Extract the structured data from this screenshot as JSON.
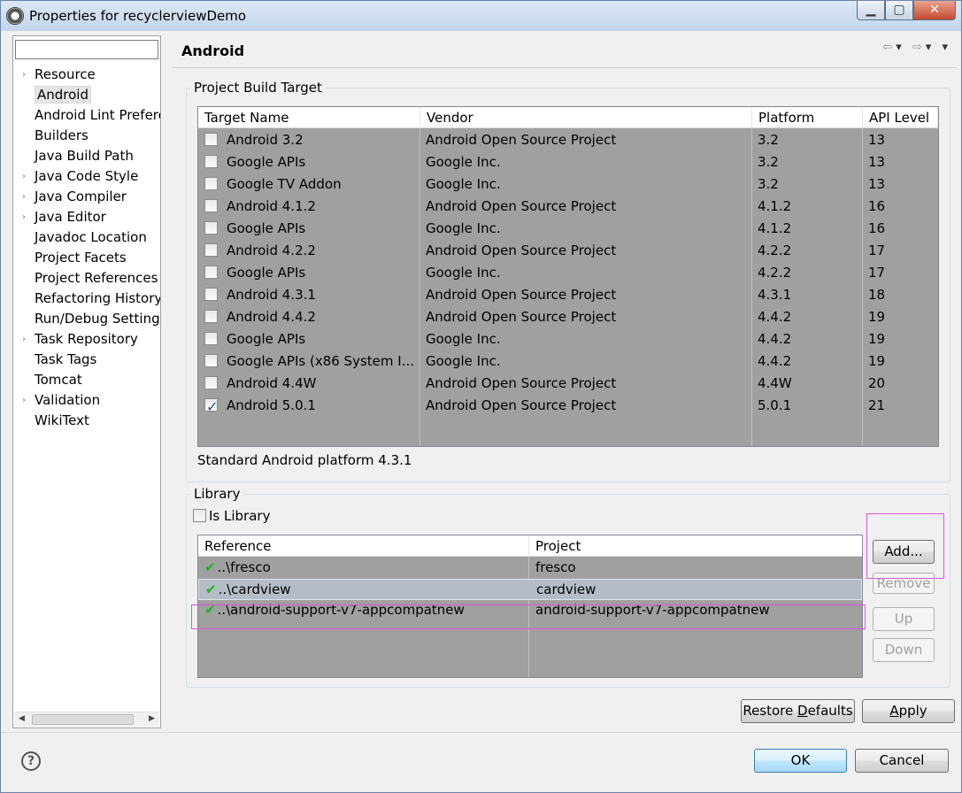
{
  "window": {
    "title": "Properties for recyclerviewDemo",
    "controls": [
      "minimize-icon",
      "maximize-icon",
      "close-icon"
    ]
  },
  "nav": {
    "filter_value": "",
    "items": [
      {
        "label": "Resource",
        "expandable": true
      },
      {
        "label": "Android",
        "expandable": false,
        "selected": true
      },
      {
        "label": "Android Lint Preferences",
        "expandable": false
      },
      {
        "label": "Builders",
        "expandable": false
      },
      {
        "label": "Java Build Path",
        "expandable": false
      },
      {
        "label": "Java Code Style",
        "expandable": true
      },
      {
        "label": "Java Compiler",
        "expandable": true
      },
      {
        "label": "Java Editor",
        "expandable": true
      },
      {
        "label": "Javadoc Location",
        "expandable": false
      },
      {
        "label": "Project Facets",
        "expandable": false
      },
      {
        "label": "Project References",
        "expandable": false
      },
      {
        "label": "Refactoring History",
        "expandable": false
      },
      {
        "label": "Run/Debug Settings",
        "expandable": false
      },
      {
        "label": "Task Repository",
        "expandable": true
      },
      {
        "label": "Task Tags",
        "expandable": false
      },
      {
        "label": "Tomcat",
        "expandable": false
      },
      {
        "label": "Validation",
        "expandable": true
      },
      {
        "label": "WikiText",
        "expandable": false
      }
    ]
  },
  "page": {
    "title": "Android"
  },
  "build_target": {
    "group_label": "Project Build Target",
    "columns": [
      "Target Name",
      "Vendor",
      "Platform",
      "API Level"
    ],
    "rows": [
      {
        "name": "Android 3.2",
        "vendor": "Android Open Source Project",
        "platform": "3.2",
        "api": "13",
        "checked": false
      },
      {
        "name": "Google APIs",
        "vendor": "Google Inc.",
        "platform": "3.2",
        "api": "13",
        "checked": false
      },
      {
        "name": "Google TV Addon",
        "vendor": "Google Inc.",
        "platform": "3.2",
        "api": "13",
        "checked": false
      },
      {
        "name": "Android 4.1.2",
        "vendor": "Android Open Source Project",
        "platform": "4.1.2",
        "api": "16",
        "checked": false
      },
      {
        "name": "Google APIs",
        "vendor": "Google Inc.",
        "platform": "4.1.2",
        "api": "16",
        "checked": false
      },
      {
        "name": "Android 4.2.2",
        "vendor": "Android Open Source Project",
        "platform": "4.2.2",
        "api": "17",
        "checked": false
      },
      {
        "name": "Google APIs",
        "vendor": "Google Inc.",
        "platform": "4.2.2",
        "api": "17",
        "checked": false
      },
      {
        "name": "Android 4.3.1",
        "vendor": "Android Open Source Project",
        "platform": "4.3.1",
        "api": "18",
        "checked": false
      },
      {
        "name": "Android 4.4.2",
        "vendor": "Android Open Source Project",
        "platform": "4.4.2",
        "api": "19",
        "checked": false
      },
      {
        "name": "Google APIs",
        "vendor": "Google Inc.",
        "platform": "4.4.2",
        "api": "19",
        "checked": false
      },
      {
        "name": "Google APIs (x86 System I...",
        "vendor": "Google Inc.",
        "platform": "4.4.2",
        "api": "19",
        "checked": false
      },
      {
        "name": "Android 4.4W",
        "vendor": "Android Open Source Project",
        "platform": "4.4W",
        "api": "20",
        "checked": false
      },
      {
        "name": "Android 5.0.1",
        "vendor": "Android Open Source Project",
        "platform": "5.0.1",
        "api": "21",
        "checked": true
      }
    ],
    "status_text": "Standard Android platform 4.3.1"
  },
  "library": {
    "group_label": "Library",
    "is_library_label": "Is Library",
    "is_library_checked": false,
    "columns": [
      "Reference",
      "Project"
    ],
    "rows": [
      {
        "reference": "..\\fresco",
        "project": "fresco",
        "status_icon": "check-icon"
      },
      {
        "reference": "..\\cardview",
        "project": "cardview",
        "status_icon": "check-icon",
        "selected": true
      },
      {
        "reference": "..\\android-support-v7-appcompatnew",
        "project": "android-support-v7-appcompatnew",
        "status_icon": "check-icon"
      }
    ],
    "buttons": {
      "add": "Add...",
      "remove": "Remove",
      "up": "Up",
      "down": "Down"
    }
  },
  "actions": {
    "restore_defaults_pre": "Restore ",
    "restore_defaults_mnemonic": "D",
    "restore_defaults_post": "efaults",
    "apply_mnemonic": "A",
    "apply_post": "pply",
    "ok": "OK",
    "cancel": "Cancel",
    "help_glyph": "?"
  },
  "colors": {
    "annotation": "#e050e0",
    "table_bg": "#a0a0a0",
    "check_green": "#1ab51a"
  }
}
